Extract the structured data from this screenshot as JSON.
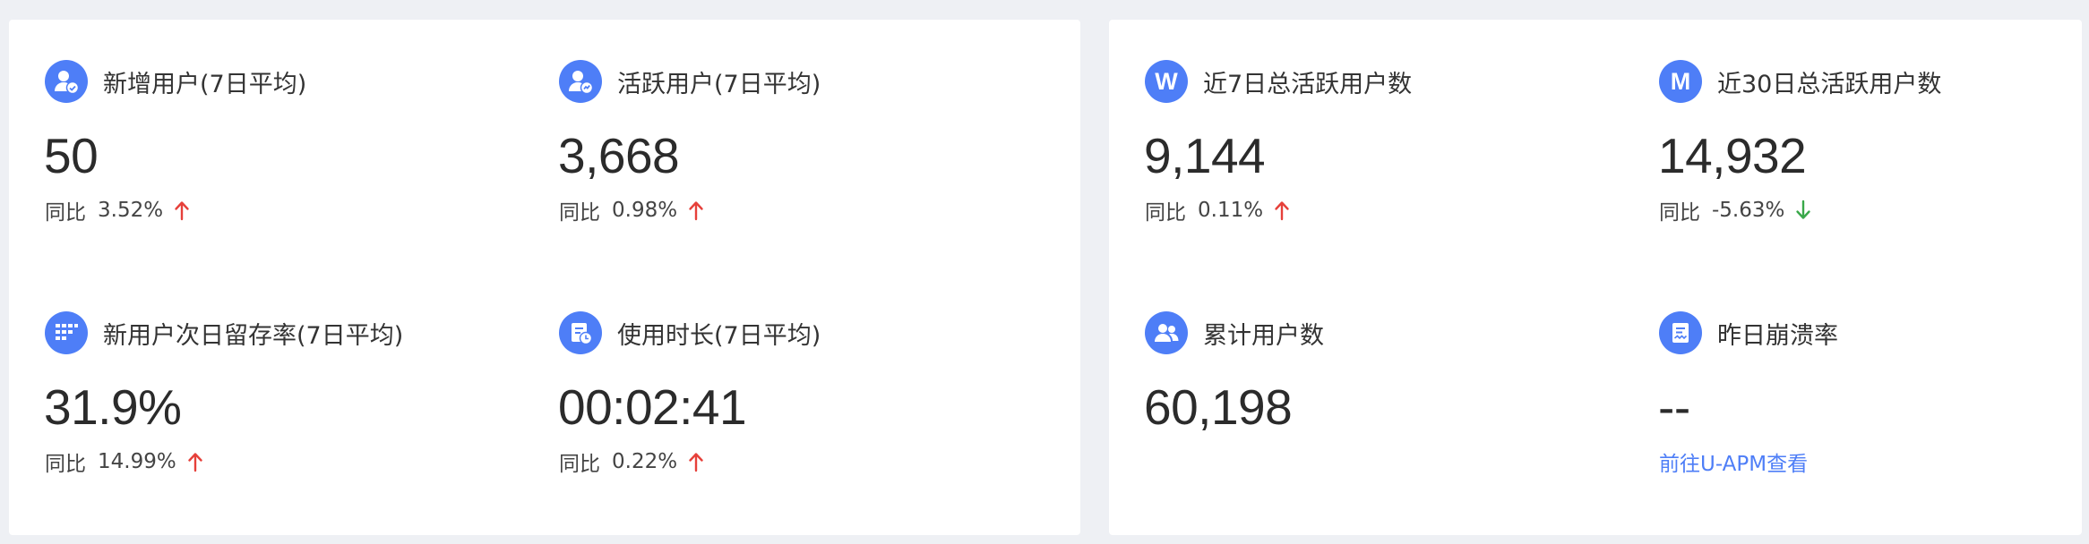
{
  "colors": {
    "accent": "#4e7ef7",
    "up": "#e6403a",
    "down": "#39a84a"
  },
  "left_panel": {
    "metrics": [
      {
        "title": "新增用户(7日平均)",
        "value": "50",
        "compare_label": "同比",
        "compare_value": "3.52%",
        "trend": "up",
        "icon": "user-plus-icon"
      },
      {
        "title": "活跃用户(7日平均)",
        "value": "3,668",
        "compare_label": "同比",
        "compare_value": "0.98%",
        "trend": "up",
        "icon": "active-user-icon"
      },
      {
        "title": "新用户次日留存率(7日平均)",
        "value": "31.9%",
        "compare_label": "同比",
        "compare_value": "14.99%",
        "trend": "up",
        "icon": "retention-grid-icon"
      },
      {
        "title": "使用时长(7日平均)",
        "value": "00:02:41",
        "compare_label": "同比",
        "compare_value": "0.22%",
        "trend": "up",
        "icon": "usage-time-icon"
      }
    ]
  },
  "right_panel": {
    "metrics": [
      {
        "title": "近7日总活跃用户数",
        "value": "9,144",
        "compare_label": "同比",
        "compare_value": "0.11%",
        "trend": "up",
        "icon_letter": "W"
      },
      {
        "title": "近30日总活跃用户数",
        "value": "14,932",
        "compare_label": "同比",
        "compare_value": "-5.63%",
        "trend": "down",
        "icon_letter": "M"
      },
      {
        "title": "累计用户数",
        "value": "60,198",
        "icon": "users-group-icon"
      },
      {
        "title": "昨日崩溃率",
        "value": "--",
        "link": "前往U-APM查看",
        "icon": "crash-report-icon"
      }
    ]
  }
}
